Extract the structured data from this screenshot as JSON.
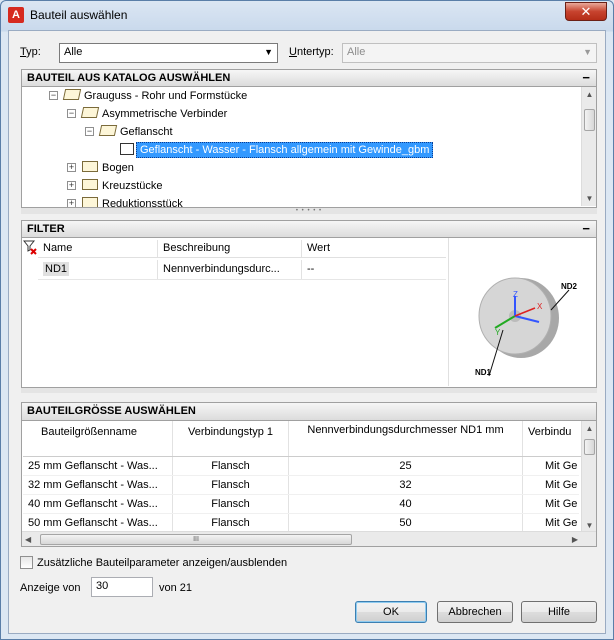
{
  "window": {
    "title": "Bauteil auswählen",
    "app_icon": "A",
    "close_glyph": "✕"
  },
  "typ": {
    "label_first": "T",
    "label_rest": "yp:",
    "value": "Alle"
  },
  "untertyp": {
    "label_first": "U",
    "label_rest": "ntertyp:",
    "value": "Alle"
  },
  "catalog": {
    "header": "BAUTEIL AUS KATALOG AUSWÄHLEN",
    "collapse_glyph": "−",
    "tree": [
      {
        "label": "Grauguss - Rohr und Formstücke",
        "expander": "−"
      },
      {
        "label": "Asymmetrische Verbinder",
        "expander": "−"
      },
      {
        "label": "Geflanscht",
        "expander": "−"
      },
      {
        "label": "Geflanscht - Wasser - Flansch allgemein mit Gewinde_gbm",
        "selected": true
      },
      {
        "label": "Bogen",
        "expander": "+"
      },
      {
        "label": "Kreuzstücke",
        "expander": "+"
      },
      {
        "label": "Reduktionsstück",
        "expander": "+"
      }
    ]
  },
  "filter": {
    "header": "FILTER",
    "collapse_glyph": "−",
    "columns": [
      "Name",
      "Beschreibung",
      "Wert"
    ],
    "rows": [
      {
        "name": "ND1",
        "beschreibung": "Nennverbindungsdurc...",
        "wert": "--"
      }
    ],
    "preview": {
      "label_nd1": "ND1",
      "label_nd2": "ND2",
      "axis_x": "X",
      "axis_y": "Y",
      "axis_z": "Z"
    }
  },
  "size": {
    "header": "BAUTEILGRÖSSE AUSWÄHLEN",
    "columns": [
      "Bauteilgrößenname",
      "Verbindungstyp  1",
      "Nennverbindungsdurchmesser  ND1 mm",
      "Verbindu"
    ],
    "rows": [
      {
        "name": "25 mm Geflanscht - Was...",
        "typ": "Flansch",
        "nd": "25",
        "verb": "Mit Ge"
      },
      {
        "name": "32 mm Geflanscht - Was...",
        "typ": "Flansch",
        "nd": "32",
        "verb": "Mit Ge"
      },
      {
        "name": "40 mm Geflanscht - Was...",
        "typ": "Flansch",
        "nd": "40",
        "verb": "Mit Ge"
      },
      {
        "name": "50 mm Geflanscht - Was...",
        "typ": "Flansch",
        "nd": "50",
        "verb": "Mit Ge"
      }
    ],
    "hscroll_thumb_glyph": "III"
  },
  "extra_params_label": "Zusätzliche Bauteilparameter anzeigen/ausblenden",
  "anzeige": {
    "label": "Anzeige von",
    "value": "30",
    "suffix": "von 21"
  },
  "buttons": {
    "ok": "OK",
    "abbrechen": "Abbrechen",
    "hilfe": "Hilfe"
  },
  "colors": {
    "selection": "#3399ff",
    "close": "#c7432e",
    "app_icon": "#d62a1f"
  }
}
